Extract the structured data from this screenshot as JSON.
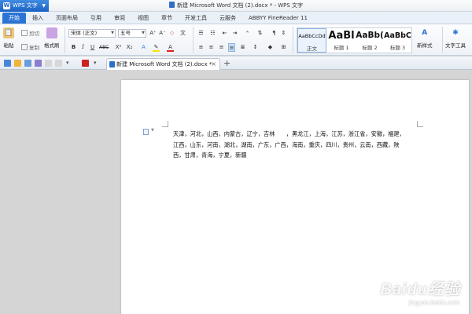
{
  "app": {
    "name": "WPS 文字"
  },
  "window": {
    "title": "新建 Microsoft Word 文档 (2).docx * - WPS 文字"
  },
  "menu": {
    "tabs": [
      "开始",
      "插入",
      "页面布局",
      "引用",
      "审阅",
      "视图",
      "章节",
      "开发工具",
      "云服务",
      "ABBYY FineReader 11"
    ]
  },
  "ribbon": {
    "paste": "粘贴",
    "cut": "剪切",
    "copy": "复制",
    "format_painter": "格式刷",
    "font_name": "宋体 (正文)",
    "font_size": "五号",
    "bold": "B",
    "italic": "I",
    "underline": "U",
    "strikethrough": "ABC",
    "superscript": "X²",
    "subscript": "X₂",
    "font_grow": "A⁺",
    "font_shrink": "A⁻",
    "styles": [
      {
        "preview": "AaBbCcDd",
        "name": "正文"
      },
      {
        "preview": "AaBl",
        "name": "标题 1"
      },
      {
        "preview": "AaBb(",
        "name": "标题 2"
      },
      {
        "preview": "AaBbC",
        "name": "标题 3"
      }
    ],
    "new_style": "新样式",
    "text_tools": "文字工具"
  },
  "doc_tab": {
    "label": "新建 Microsoft Word 文档 (2).docx *"
  },
  "document": {
    "lines": [
      "天津，河北，山西，内蒙古，辽宁，吉林　　，黑龙江，上海，江苏，浙江省，安徽，福建，",
      "江西，山东，河南，湖北，湖南，广东，广西，海南，重庆，四川，贵州，云南，西藏，陕",
      "西，甘肃，青海，宁夏，新疆"
    ]
  },
  "watermark": {
    "main": "Baidu经验",
    "sub": "jingyan.baidu.com"
  },
  "colors": {
    "accent": "#2b74d4",
    "app_button": "#1c63c4",
    "workspace": "#d5d5d5"
  }
}
